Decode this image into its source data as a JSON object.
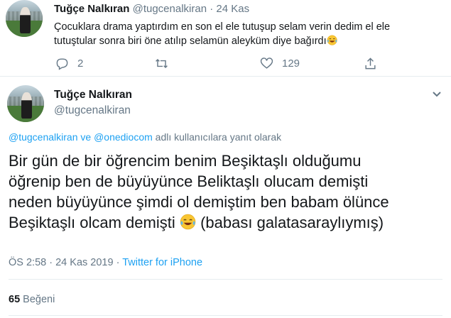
{
  "reply_tweet": {
    "name": "Tuğçe Nalkıran",
    "handle": "@tugcenalkiran",
    "separator": "·",
    "date": "24 Kas",
    "text_line1": "Çocuklara drama yaptırdım en son el ele tutuşup selam verin dedim el ele",
    "text_line2": "tutuştular sonra biri öne atılıp selamün aleyküm diye bağırdı",
    "emoji": "laughing-tears-emoji",
    "actions": {
      "reply_count": "2",
      "retweet_count": "",
      "like_count": "129"
    }
  },
  "main_tweet": {
    "name": "Tuğçe Nalkıran",
    "handle": "@tugcenalkiran",
    "reply_to": {
      "mention1": "@tugcenalkiran",
      "conjunction": "ve",
      "mention2": "@onediocom",
      "suffix": "adlı kullanıcılara yanıt olarak"
    },
    "text_line1": "Bir gün de bir öğrencim benim Beşiktaşlı olduğumu",
    "text_line2": "öğrenip ben de büyüyünce Beliktaşlı olucam demişti",
    "text_line3": "neden büyüyünce şimdi ol demiştim ben babam ölünce",
    "text_line4a": "Beşiktaşlı olcam demişti",
    "text_line4b": "(babası galatasaraylıymış)",
    "meta": {
      "time": "ÖS 2:58",
      "separator": "·",
      "date": "24 Kas 2019",
      "source": "Twitter for iPhone"
    },
    "likes": {
      "count": "65",
      "label": "Beğeni"
    }
  },
  "colors": {
    "link": "#1da1f2",
    "muted": "#657786",
    "text": "#14171a",
    "divider": "#e6ecf0"
  }
}
